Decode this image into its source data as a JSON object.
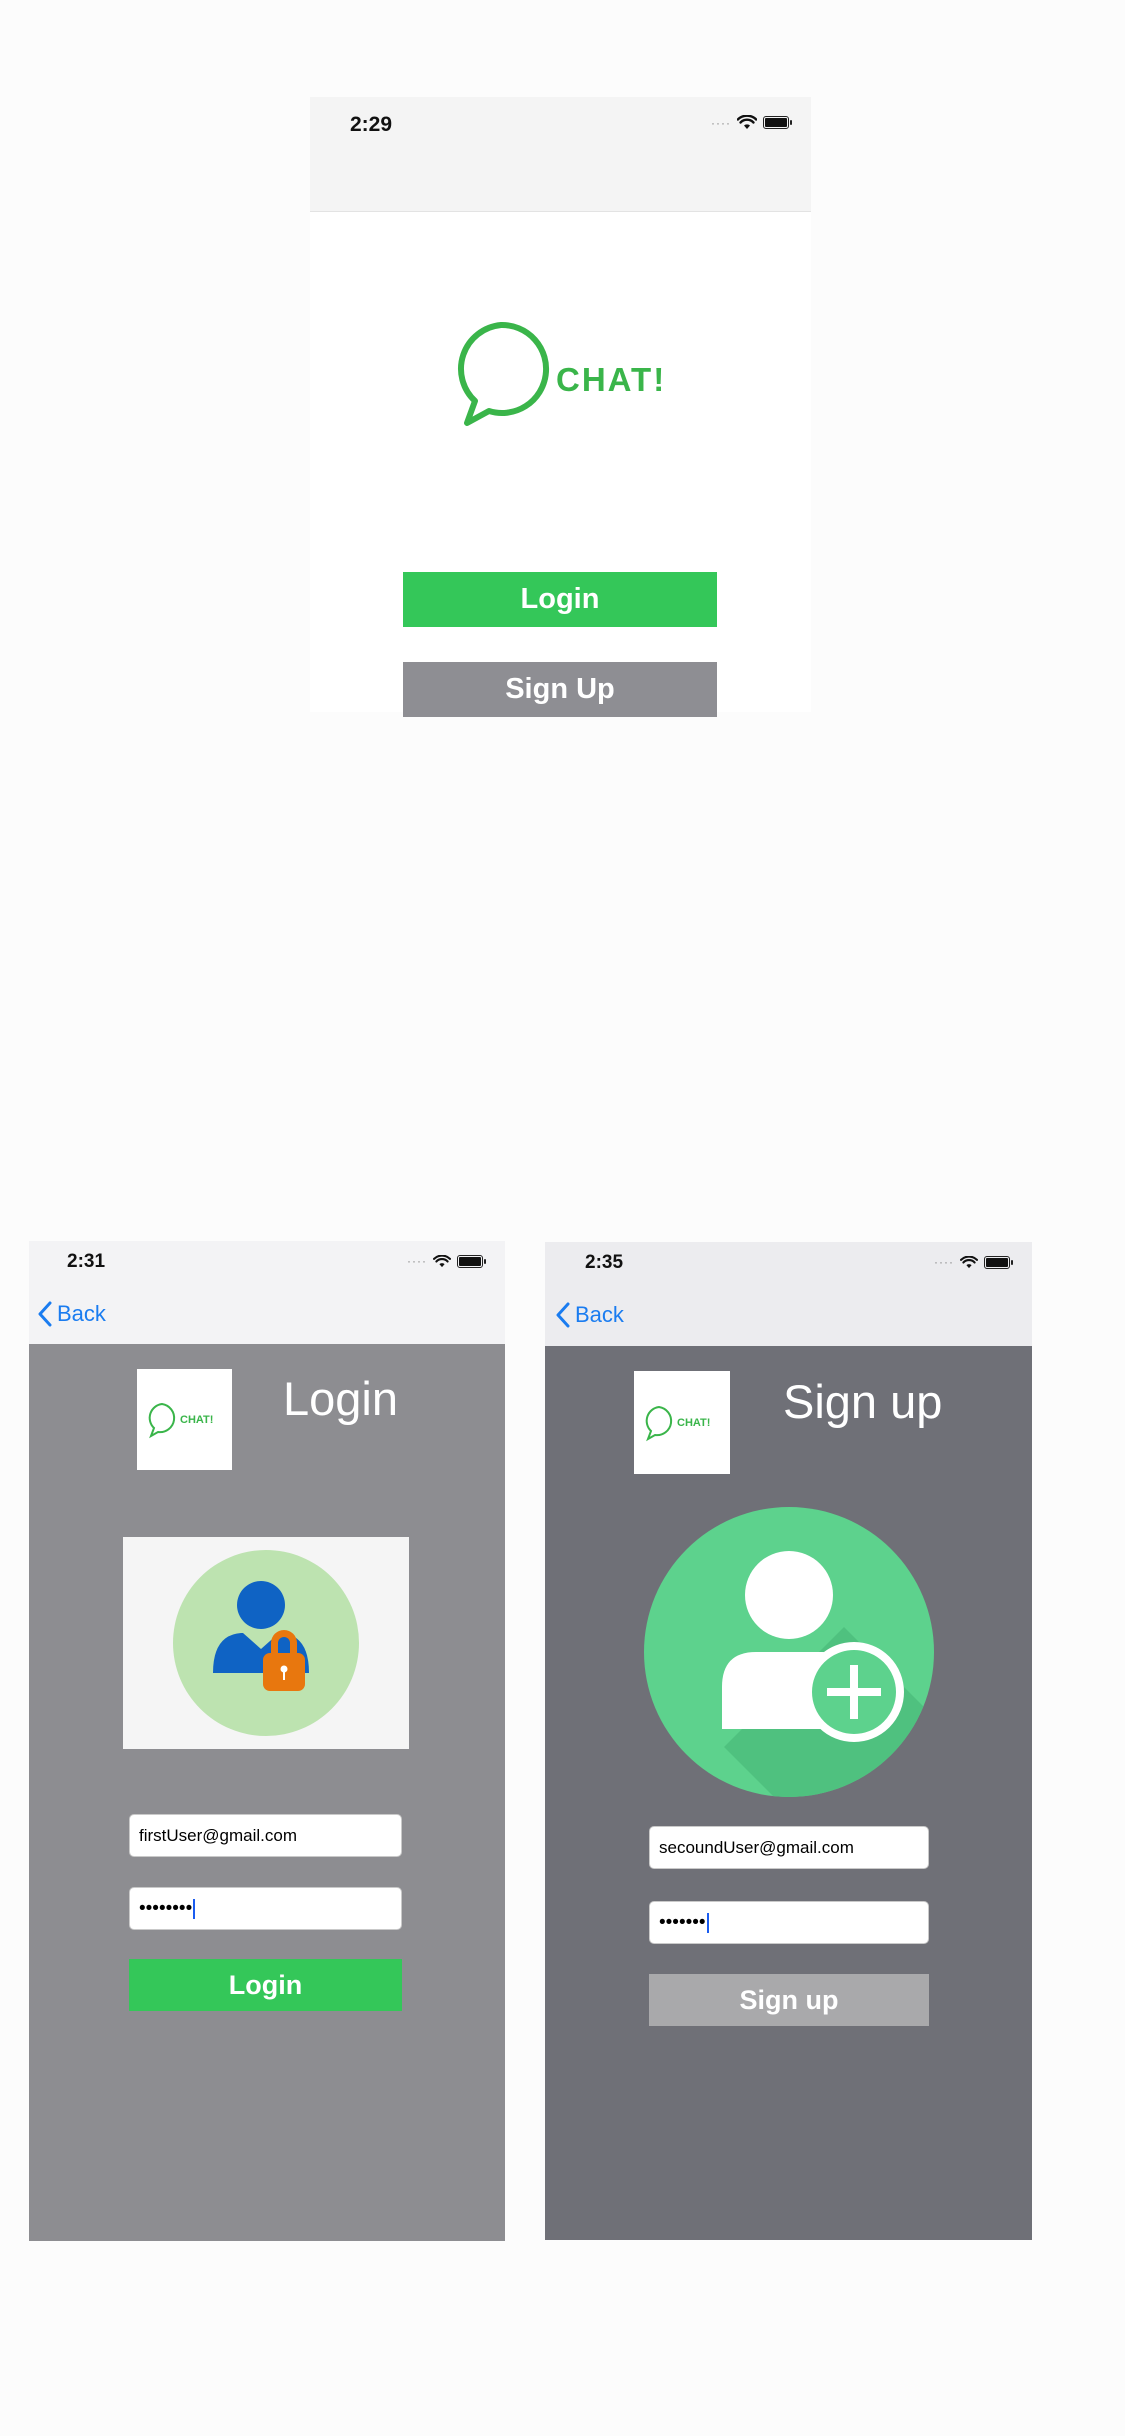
{
  "main_screen": {
    "status_time": "2:29",
    "logo_text": "CHAT!",
    "login_label": "Login",
    "signup_label": "Sign Up"
  },
  "login_screen": {
    "status_time": "2:31",
    "back_label": "Back",
    "logo_text": "CHAT!",
    "title": "Login",
    "email_value": "firstUser@gmail.com",
    "password_mask": "••••••••",
    "submit_label": "Login"
  },
  "signup_screen": {
    "status_time": "2:35",
    "back_label": "Back",
    "logo_text": "CHAT!",
    "title": "Sign up",
    "email_value": "secoundUser@gmail.com",
    "password_mask": "•••••••",
    "submit_label": "Sign up"
  },
  "colors": {
    "accent_green": "#34c759",
    "logo_green": "#3ab54a",
    "signup_gray": "#8e8e93",
    "login_bg": "#8d8d91",
    "signup_bg": "#6f7077",
    "link_blue": "#1a7cf0"
  },
  "icons": [
    "chat-bubble-icon",
    "wifi-icon",
    "battery-icon",
    "signal-icon",
    "chevron-left-icon",
    "user-lock-icon",
    "user-add-icon"
  ]
}
